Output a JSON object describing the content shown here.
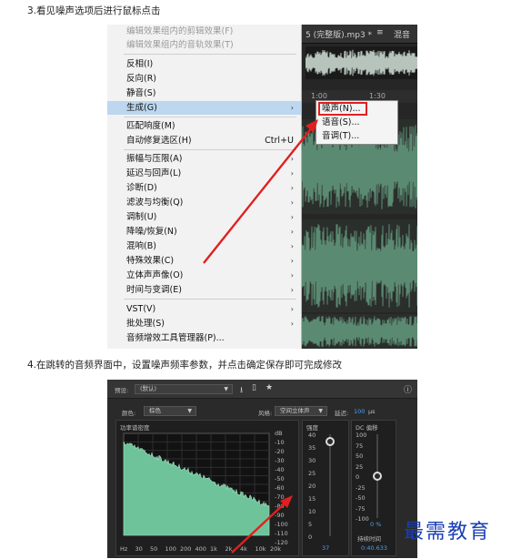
{
  "captions": {
    "step3": "3.看见噪声选项后进行鼠标点击",
    "step4": "4.在跳转的音频界面中，设置噪声频率参数，并点击确定保存即可完成修改"
  },
  "menu": {
    "items": [
      {
        "label": "编辑效果组内的剪辑效果(F)",
        "disabled": true
      },
      {
        "label": "编辑效果组内的音轨效果(T)",
        "disabled": true
      },
      {
        "label": "反相(I)"
      },
      {
        "label": "反向(R)"
      },
      {
        "label": "静音(S)"
      },
      {
        "label": "生成(G)",
        "submenu": true,
        "highlighted": true
      },
      {
        "label": "匹配响度(M)"
      },
      {
        "label": "自动修复选区(H)",
        "shortcut": "Ctrl+U"
      },
      {
        "label": "振幅与压限(A)",
        "submenu": true
      },
      {
        "label": "延迟与回声(L)",
        "submenu": true
      },
      {
        "label": "诊断(D)",
        "submenu": true
      },
      {
        "label": "滤波与均衡(Q)",
        "submenu": true
      },
      {
        "label": "调制(U)",
        "submenu": true
      },
      {
        "label": "降噪/恢复(N)",
        "submenu": true
      },
      {
        "label": "混响(B)",
        "submenu": true
      },
      {
        "label": "特殊效果(C)",
        "submenu": true
      },
      {
        "label": "立体声声像(O)",
        "submenu": true
      },
      {
        "label": "时间与变调(E)",
        "submenu": true
      },
      {
        "label": "VST(V)",
        "submenu": true
      },
      {
        "label": "批处理(S)",
        "submenu": true
      },
      {
        "label": "音频增效工具管理器(P)..."
      }
    ],
    "submenu_arrow": "›"
  },
  "submenu": {
    "items": [
      "噪声(N)...",
      "语音(S)...",
      "音调(T)..."
    ]
  },
  "editor": {
    "tab_file": "5 (完整版).mp3 *",
    "tab_menu": "≡",
    "tab_mix": "混音",
    "ruler_1": "1:00",
    "ruler_2": "1:30"
  },
  "dialog": {
    "preset_label": "预设:",
    "preset_value": "(默认)",
    "color_label": "颜色:",
    "color_value": "棕色",
    "style_label": "风格:",
    "style_value": "空间立体声",
    "delay_label": "延迟:",
    "delay_value": "100",
    "delay_unit": "μs",
    "psd_title": "功率谱密度",
    "intensity_title": "强度",
    "dc_title": "DC 偏移",
    "intensity_value": "37",
    "dc_value": "0",
    "dc_unit": "%",
    "duration_label": "持续时间",
    "duration_value": "0:40.633",
    "db_ticks": [
      "dB",
      "-10",
      "-20",
      "-30",
      "-40",
      "-50",
      "-60",
      "-70",
      "-80",
      "-90",
      "-100",
      "-110",
      "-120"
    ],
    "freq_ticks": [
      "Hz",
      "30",
      "50",
      "100",
      "200",
      "400",
      "1k",
      "2k",
      "4k",
      "10k",
      "20k"
    ],
    "intensity_ticks": [
      "40",
      "35",
      "30",
      "25",
      "20",
      "15",
      "10",
      "5",
      "0"
    ],
    "dc_ticks": [
      "100",
      "75",
      "50",
      "25",
      "0",
      "-25",
      "-50",
      "-75",
      "-100"
    ],
    "icons": {
      "save": "save-icon",
      "delete": "trash-icon",
      "favorite": "star-icon",
      "info": "info-icon"
    },
    "spectrum_color": "#6fc39a"
  },
  "watermark": "最需教育",
  "colors": {
    "highlight": "#bcd7ef",
    "annotation_red": "#e02020",
    "waveform": "#5b8a72",
    "accent_blue": "#4a9ff5",
    "watermark_blue": "#1a3fb4"
  }
}
